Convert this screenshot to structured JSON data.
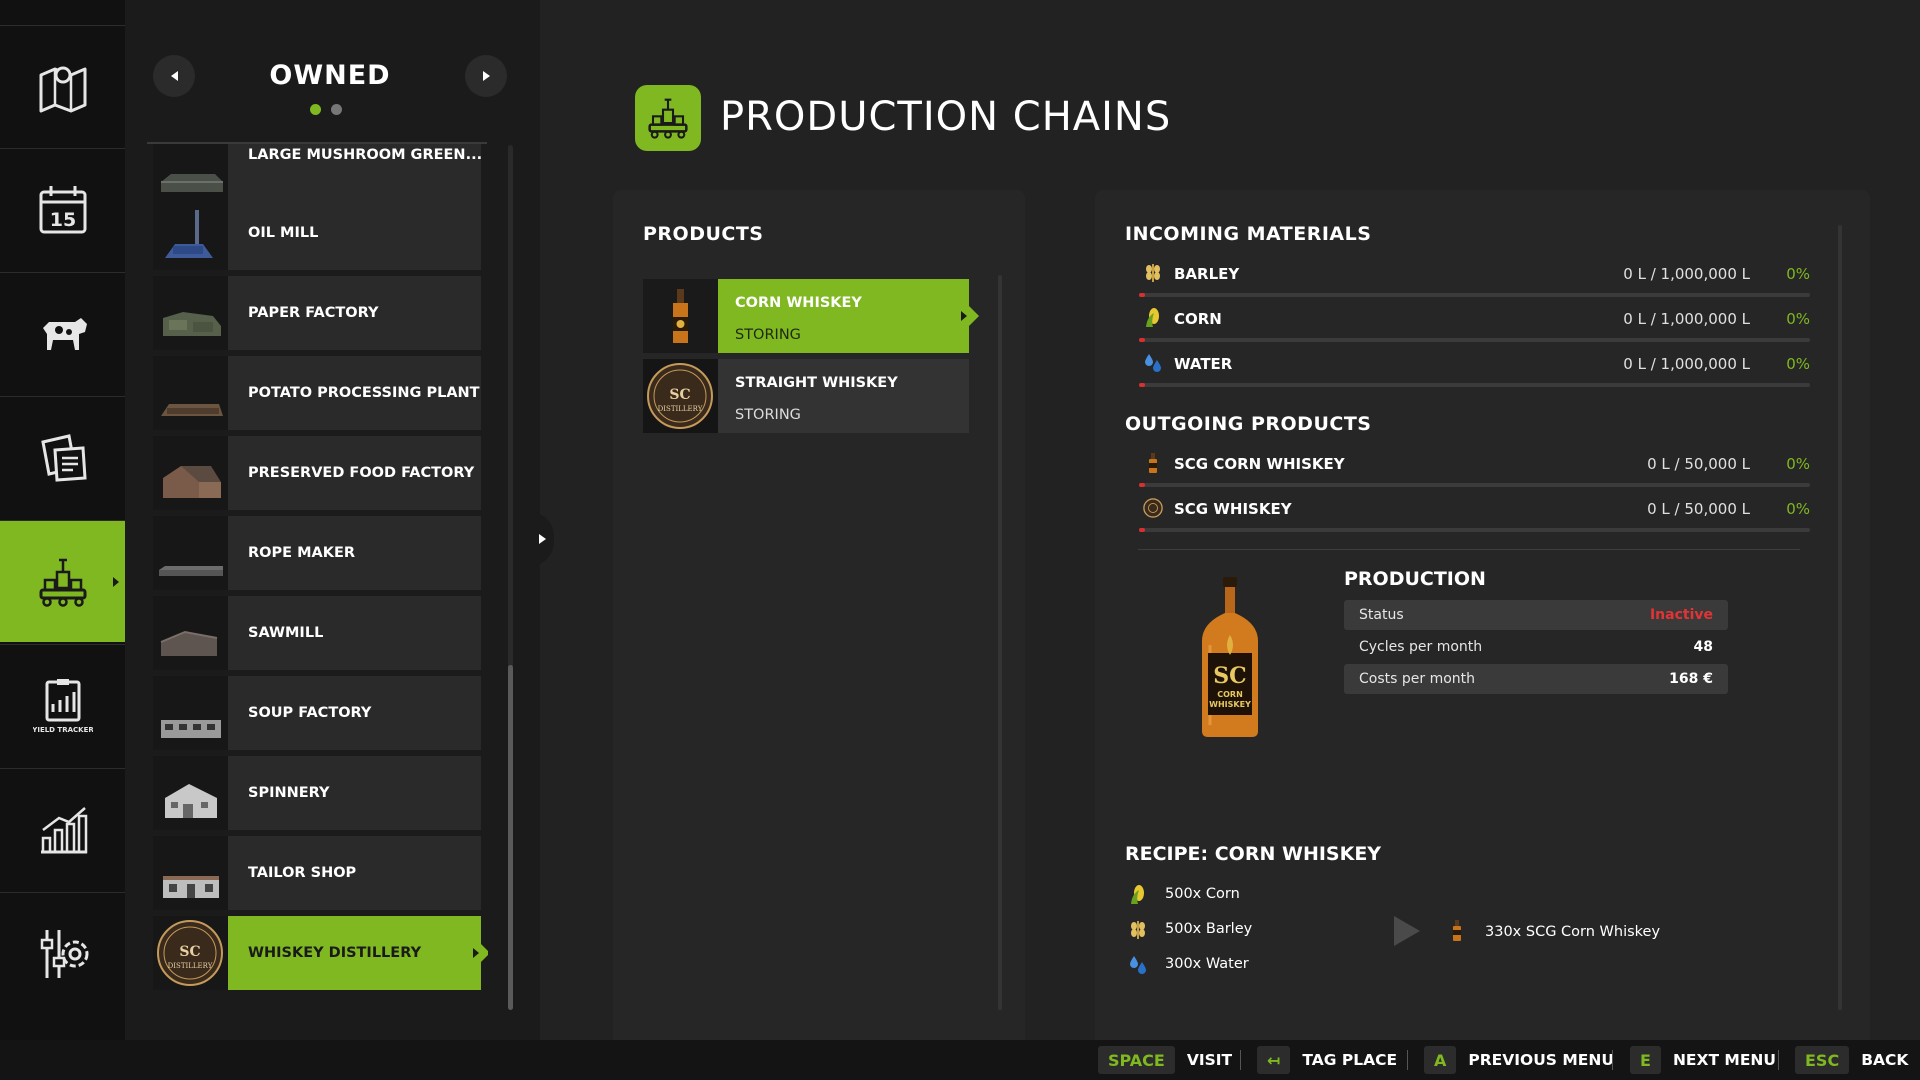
{
  "rail": {
    "items": [
      {
        "icon": "map-icon"
      },
      {
        "icon": "calendar-icon",
        "day": "15"
      },
      {
        "icon": "cow-icon"
      },
      {
        "icon": "contracts-icon"
      },
      {
        "icon": "production-icon",
        "active": true
      },
      {
        "icon": "yield-tracker-icon",
        "label": "YIELD TRACKER"
      },
      {
        "icon": "statistics-icon"
      },
      {
        "icon": "settings-icon"
      }
    ]
  },
  "list": {
    "title": "OWNED",
    "page": 1,
    "pages": 2,
    "items": [
      {
        "label": "LARGE MUSHROOM GREEN..."
      },
      {
        "label": "OIL MILL"
      },
      {
        "label": "PAPER FACTORY"
      },
      {
        "label": "POTATO PROCESSING PLANT"
      },
      {
        "label": "PRESERVED FOOD FACTORY"
      },
      {
        "label": "ROPE MAKER"
      },
      {
        "label": "SAWMILL"
      },
      {
        "label": "SOUP FACTORY"
      },
      {
        "label": "SPINNERY"
      },
      {
        "label": "TAILOR SHOP"
      },
      {
        "label": "WHISKEY DISTILLERY",
        "selected": true
      }
    ]
  },
  "header": {
    "title": "PRODUCTION CHAINS"
  },
  "products": {
    "title": "PRODUCTS",
    "items": [
      {
        "name": "CORN WHISKEY",
        "state": "STORING",
        "selected": true
      },
      {
        "name": "STRAIGHT WHISKEY",
        "state": "STORING"
      }
    ]
  },
  "thumb_text": {
    "sc": "SC",
    "distillery": "DISTILLERY"
  },
  "incoming": {
    "title": "INCOMING MATERIALS",
    "items": [
      {
        "icon": "barley-icon",
        "name": "BARLEY",
        "amount": "0 L / 1,000,000 L",
        "percent": "0%",
        "fill": 0
      },
      {
        "icon": "corn-icon",
        "name": "CORN",
        "amount": "0 L / 1,000,000 L",
        "percent": "0%",
        "fill": 0
      },
      {
        "icon": "water-icon",
        "name": "WATER",
        "amount": "0 L / 1,000,000 L",
        "percent": "0%",
        "fill": 0
      }
    ]
  },
  "outgoing": {
    "title": "OUTGOING PRODUCTS",
    "items": [
      {
        "icon": "corn-whiskey-bottle-icon",
        "name": "SCG CORN WHISKEY",
        "amount": "0 L / 50,000 L",
        "percent": "0%",
        "fill": 0
      },
      {
        "icon": "whiskey-barrel-icon",
        "name": "SCG WHISKEY",
        "amount": "0 L / 50,000 L",
        "percent": "0%",
        "fill": 0
      }
    ]
  },
  "production": {
    "title": "PRODUCTION",
    "status_label": "Status",
    "status_value": "Inactive",
    "cycles_label": "Cycles per month",
    "cycles_value": "48",
    "costs_label": "Costs per month",
    "costs_value": "168 €",
    "bottle_label_1": "SC",
    "bottle_label_2": "CORN",
    "bottle_label_3": "WHISKEY"
  },
  "recipe": {
    "title": "RECIPE: CORN WHISKEY",
    "inputs": [
      {
        "icon": "corn-icon",
        "text": "500x Corn"
      },
      {
        "icon": "barley-icon",
        "text": "500x Barley"
      },
      {
        "icon": "water-icon",
        "text": "300x Water"
      }
    ],
    "output": {
      "icon": "corn-whiskey-bottle-icon",
      "text": "330x SCG Corn Whiskey"
    }
  },
  "hints": [
    {
      "key": "SPACE",
      "label": "VISIT"
    },
    {
      "key": "↤",
      "label": "TAG PLACE"
    },
    {
      "key": "A",
      "label": "PREVIOUS MENU"
    },
    {
      "key": "E",
      "label": "NEXT MENU"
    },
    {
      "key": "ESC",
      "label": "BACK"
    }
  ],
  "colors": {
    "accent": "#7fb820",
    "danger": "#e23434",
    "background": "#222222",
    "panel": "#262626"
  }
}
